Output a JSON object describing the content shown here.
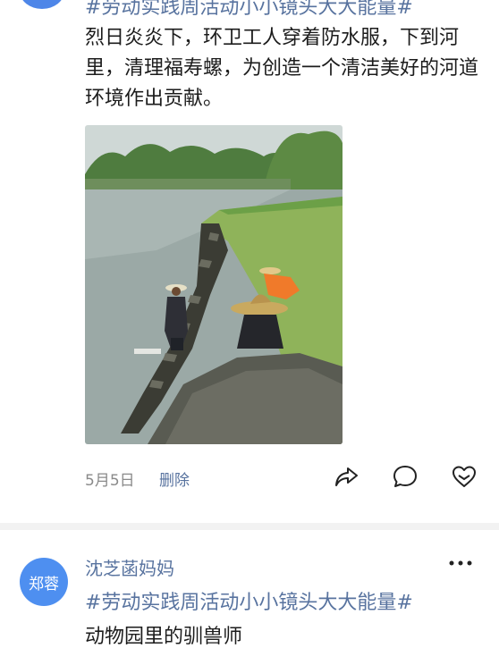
{
  "post1": {
    "hashtag": "#劳动实践周活动小小镜头大大能量#",
    "text": "烈日炎炎下，环卫工人穿着防水服，下到河里，清理福寿螺，为创造一个清洁美好的河道环境作出贡献。",
    "date": "5月5日",
    "delete_label": "删除"
  },
  "post2": {
    "avatar_text": "郑蓉",
    "username": "沈芝菡妈妈",
    "hashtag": "#劳动实践周活动小小镜头大大能量#",
    "text": "动物园里的驯兽师"
  },
  "icons": {
    "share": "share-icon",
    "comment": "comment-icon",
    "like": "like-icon",
    "more": "more-icon"
  },
  "colors": {
    "link": "#58739f",
    "avatar": "#4e8ff0",
    "meta": "#8a8a8a"
  }
}
